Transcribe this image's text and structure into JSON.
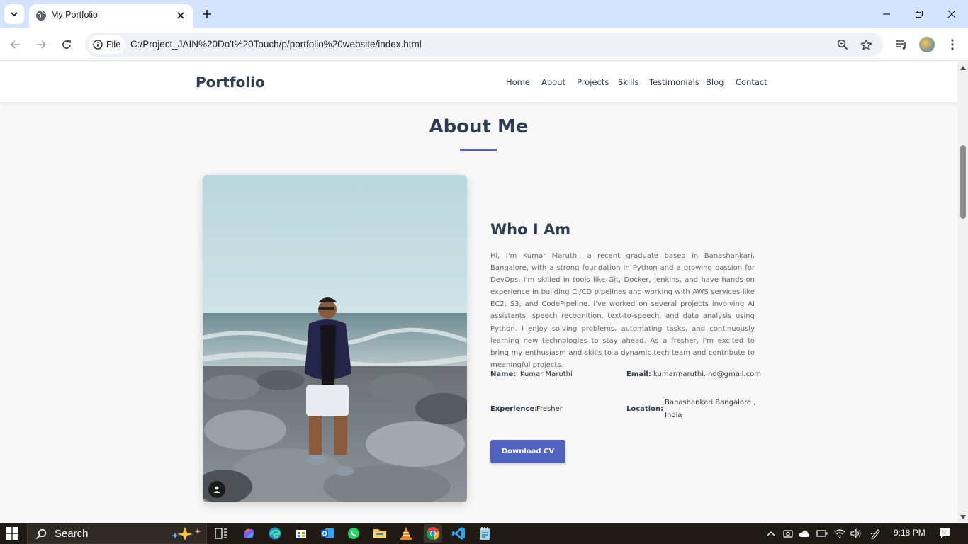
{
  "browser": {
    "tab_title": "My Portfolio",
    "chip_label": "File",
    "url": "C:/Project_JAIN%20Do't%20Touch/p/portfolio%20website/index.html"
  },
  "site": {
    "logo": "Portfolio",
    "nav": [
      "Home",
      "About",
      "Projects",
      "Skills",
      "Testimonials",
      "Blog",
      "Contact"
    ]
  },
  "about": {
    "section_title": "About Me",
    "who_title": "Who I Am",
    "bio": "Hi, I'm Kumar Maruthi, a recent graduate based in Banashankari, Bangalore, with a strong foundation in Python and a growing passion for DevOps. I'm skilled in tools like Git, Docker, Jenkins, and have hands-on experience in building CI/CD pipelines and working with AWS services like EC2, S3, and CodePipeline. I've worked on several projects involving AI assistants, speech recognition, text-to-speech, and data analysis using Python. I enjoy solving problems, automating tasks, and continuously learning new technologies to stay ahead. As a fresher, I'm excited to bring my enthusiasm and skills to a dynamic tech team and contribute to meaningful projects.",
    "info": {
      "name_label": "Name:",
      "name_value": "Kumar Maruthi",
      "email_label": "Email:",
      "email_value": "kumarmaruthi.ind@gmail.com",
      "experience_label": "Experience:",
      "experience_value": "Fresher",
      "location_label": "Location:",
      "location_value_line1": "Banashankari Bangalore ,",
      "location_value_line2": "India"
    },
    "download_label": "Download CV"
  },
  "taskbar": {
    "search_text": "Search",
    "time": "9:18 PM"
  },
  "colors": {
    "accent": "#4f62c0",
    "heading": "#2c3e50",
    "tabstrip": "#d3e3fd",
    "taskbar": "#1f1a14"
  }
}
